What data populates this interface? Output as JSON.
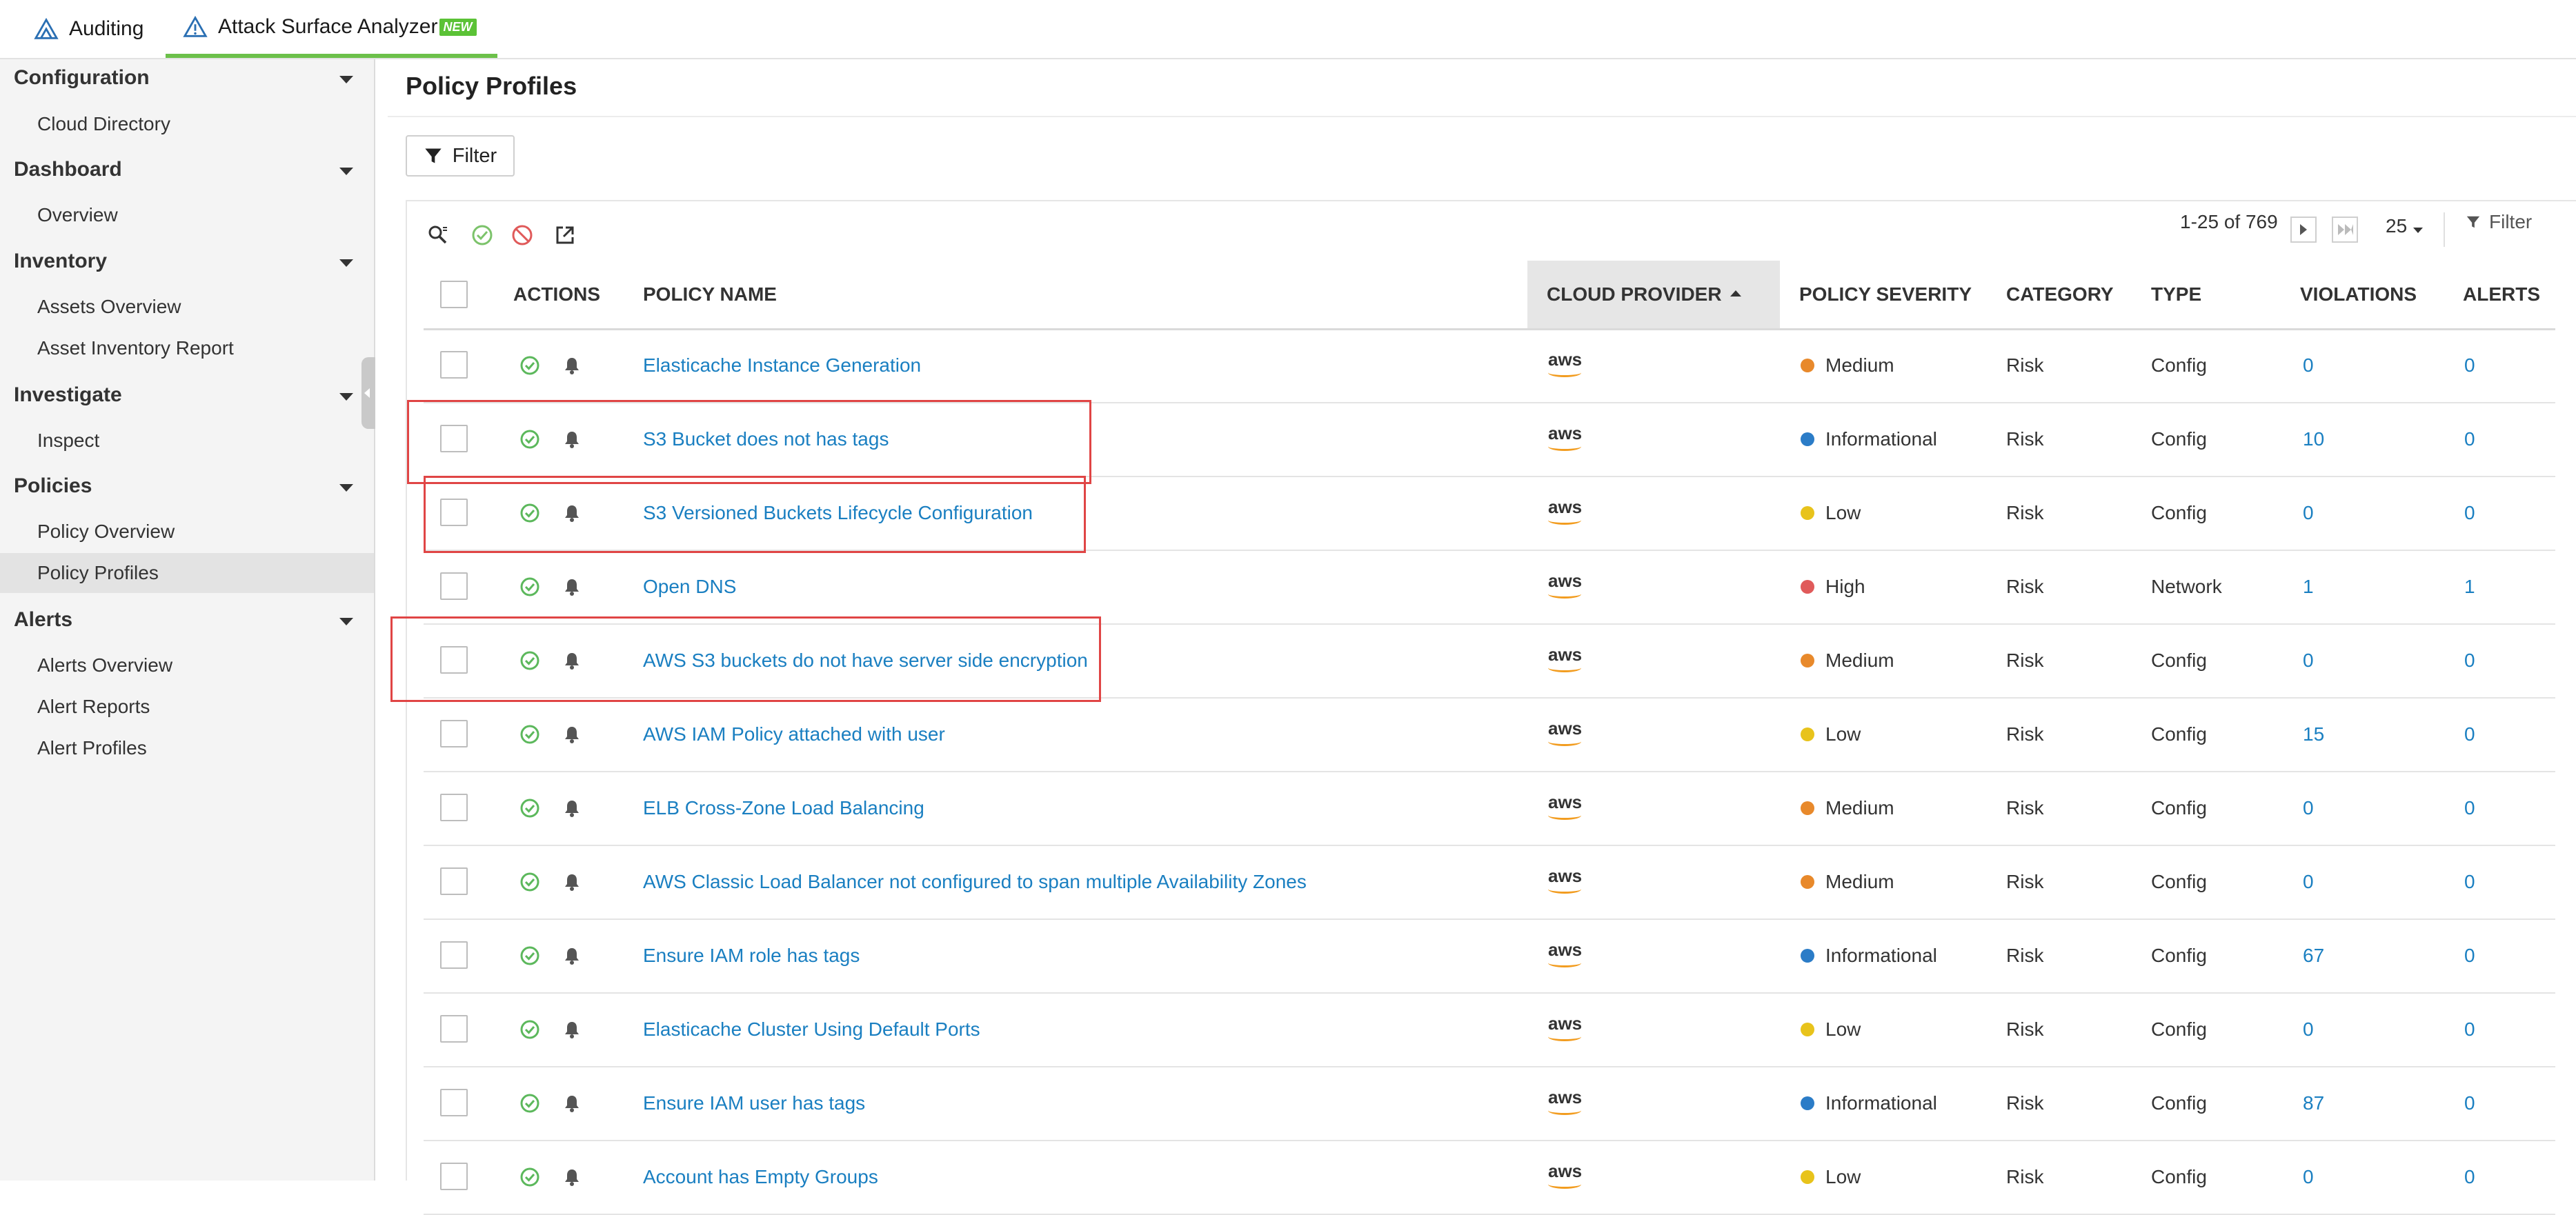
{
  "top_tabs": [
    {
      "label": "Auditing",
      "icon": "auditing-icon"
    },
    {
      "label": "Attack Surface Analyzer",
      "icon": "attack-surface-icon",
      "badge": "NEW"
    }
  ],
  "sidebar": {
    "groups": [
      {
        "label": "Configuration",
        "items": [
          "Cloud Directory"
        ]
      },
      {
        "label": "Dashboard",
        "items": [
          "Overview"
        ]
      },
      {
        "label": "Inventory",
        "items": [
          "Assets Overview",
          "Asset Inventory Report"
        ]
      },
      {
        "label": "Investigate",
        "items": [
          "Inspect"
        ]
      },
      {
        "label": "Policies",
        "items": [
          "Policy Overview",
          "Policy Profiles"
        ]
      },
      {
        "label": "Alerts",
        "items": [
          "Alerts Overview",
          "Alert Reports",
          "Alert Profiles"
        ]
      }
    ],
    "active_item": "Policy Profiles"
  },
  "page": {
    "title": "Policy Profiles",
    "filter_label": "Filter"
  },
  "toolbar": {
    "pager_text": "1-25 of 769",
    "page_size": "25",
    "column_filter_label": "Filter"
  },
  "table": {
    "columns": [
      "ACTIONS",
      "POLICY NAME",
      "CLOUD PROVIDER",
      "POLICY SEVERITY",
      "CATEGORY",
      "TYPE",
      "VIOLATIONS",
      "ALERTS"
    ],
    "sorted_column": "CLOUD PROVIDER",
    "provider_label": "aws",
    "rows": [
      {
        "name": "Elasticache Instance Generation",
        "severity": "Medium",
        "category": "Risk",
        "type": "Config",
        "violations": "0",
        "alerts": "0"
      },
      {
        "name": "S3 Bucket does not has tags",
        "severity": "Informational",
        "category": "Risk",
        "type": "Config",
        "violations": "10",
        "alerts": "0"
      },
      {
        "name": "S3 Versioned Buckets Lifecycle Configuration",
        "severity": "Low",
        "category": "Risk",
        "type": "Config",
        "violations": "0",
        "alerts": "0"
      },
      {
        "name": "Open DNS",
        "severity": "High",
        "category": "Risk",
        "type": "Network",
        "violations": "1",
        "alerts": "1"
      },
      {
        "name": "AWS S3 buckets do not have server side encryption",
        "severity": "Medium",
        "category": "Risk",
        "type": "Config",
        "violations": "0",
        "alerts": "0"
      },
      {
        "name": "AWS IAM Policy attached with user",
        "severity": "Low",
        "category": "Risk",
        "type": "Config",
        "violations": "15",
        "alerts": "0"
      },
      {
        "name": "ELB Cross-Zone Load Balancing",
        "severity": "Medium",
        "category": "Risk",
        "type": "Config",
        "violations": "0",
        "alerts": "0"
      },
      {
        "name": "AWS Classic Load Balancer not configured to span multiple Availability Zones",
        "severity": "Medium",
        "category": "Risk",
        "type": "Config",
        "violations": "0",
        "alerts": "0"
      },
      {
        "name": "Ensure IAM role has tags",
        "severity": "Informational",
        "category": "Risk",
        "type": "Config",
        "violations": "67",
        "alerts": "0"
      },
      {
        "name": "Elasticache Cluster Using Default Ports",
        "severity": "Low",
        "category": "Risk",
        "type": "Config",
        "violations": "0",
        "alerts": "0"
      },
      {
        "name": "Ensure IAM user has tags",
        "severity": "Informational",
        "category": "Risk",
        "type": "Config",
        "violations": "87",
        "alerts": "0"
      },
      {
        "name": "Account has Empty Groups",
        "severity": "Low",
        "category": "Risk",
        "type": "Config",
        "violations": "0",
        "alerts": "0"
      }
    ]
  },
  "severity_colors": {
    "Medium": "#e8892b",
    "Informational": "#2b7cc7",
    "Low": "#e8c31b",
    "High": "#e05a5a"
  },
  "colors": {
    "accent": "#6cc04a",
    "link": "#1a7fc1",
    "enabled_check": "#5cb85c",
    "disabled_icon": "#e05a5a",
    "highlight_box": "#e04545"
  }
}
